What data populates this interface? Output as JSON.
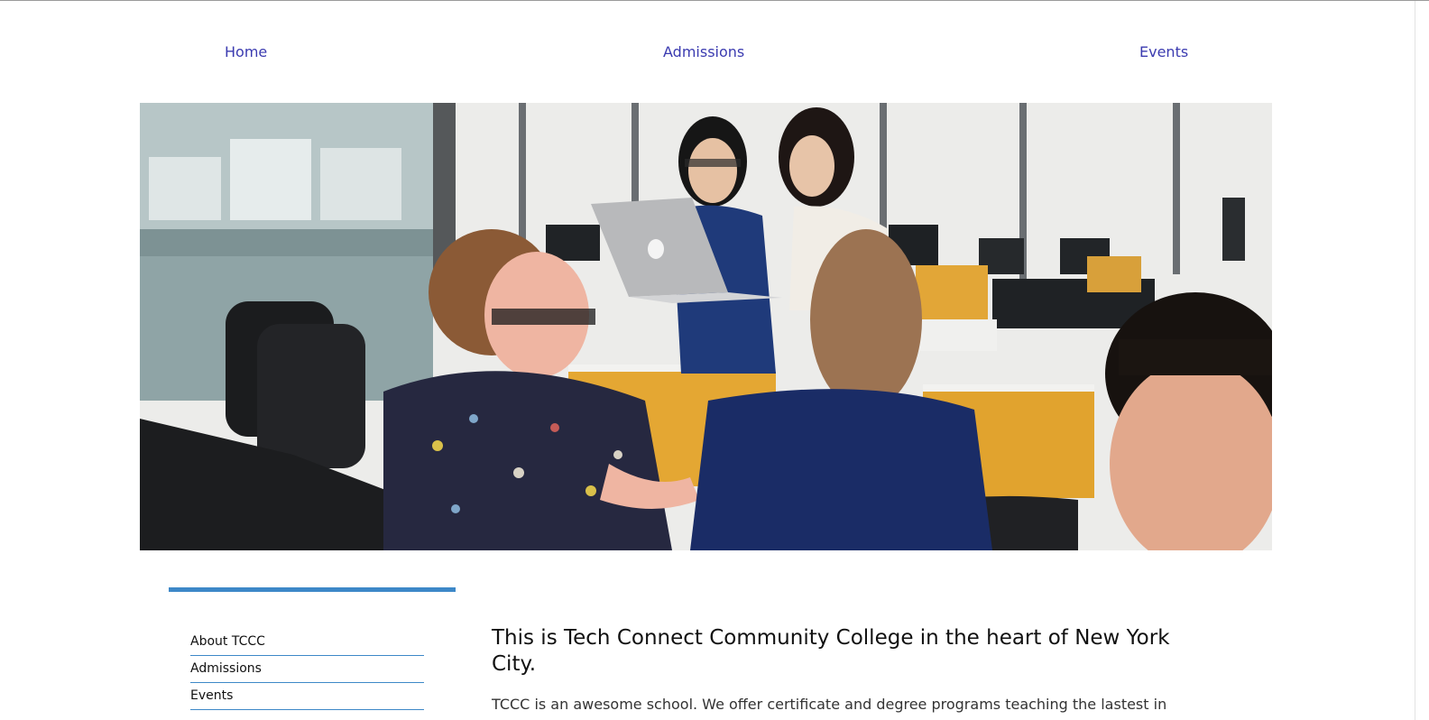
{
  "nav": {
    "home": "Home",
    "admissions": "Admissions",
    "events": "Events"
  },
  "hero": {
    "image_icon": "office-students-photo"
  },
  "sidebar": {
    "items": [
      {
        "label": "About TCCC"
      },
      {
        "label": "Admissions"
      },
      {
        "label": "Events"
      }
    ]
  },
  "main": {
    "heading": "This is Tech Connect Community College in the heart of New York City.",
    "intro": "TCCC is an awesome school. We offer certificate and degree programs teaching the lastest in"
  },
  "colors": {
    "nav_link": "#3b3bb0",
    "accent": "#3d88c8",
    "text": "#111111"
  }
}
